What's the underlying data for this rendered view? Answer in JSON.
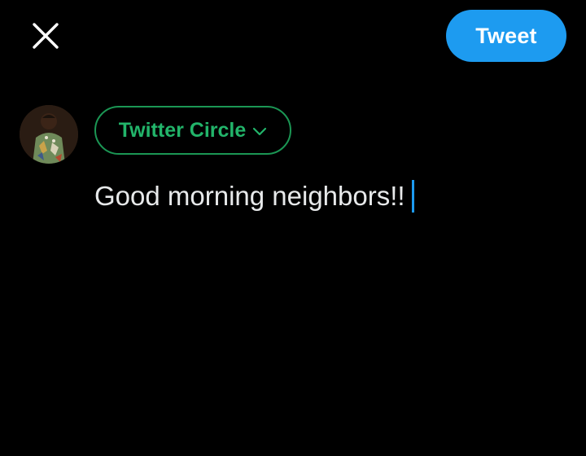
{
  "header": {
    "close_icon": "close-icon",
    "tweet_label": "Tweet"
  },
  "colors": {
    "background": "#000000",
    "tweet_button": "#1d9bf0",
    "audience_green": "#22b46a",
    "caret": "#1d9bf0",
    "text": "#e7e9ea"
  },
  "composer": {
    "audience_label": "Twitter Circle",
    "audience_icon": "chevron-down-icon",
    "text": "Good morning neighbors!!"
  }
}
